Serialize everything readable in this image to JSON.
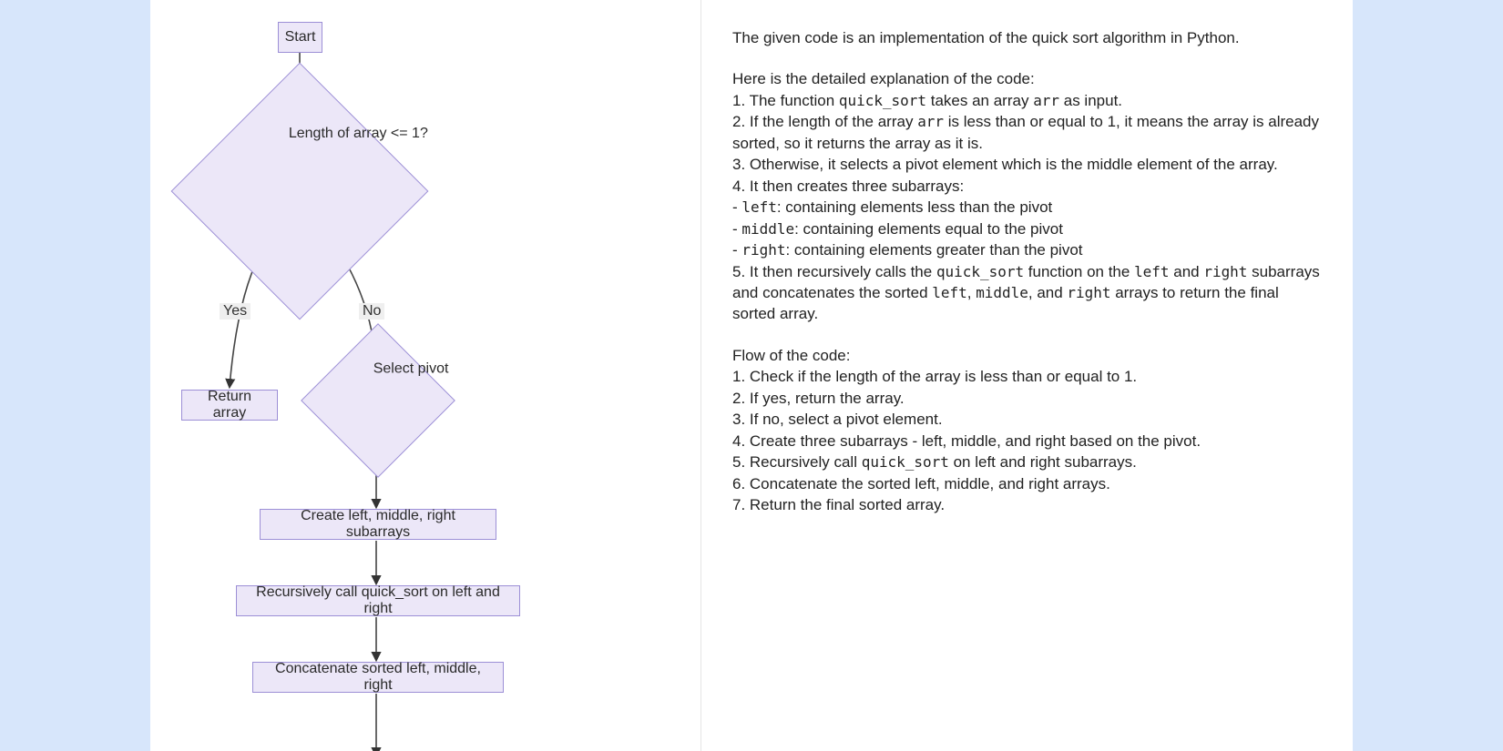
{
  "flowchart": {
    "nodes": {
      "start": "Start",
      "check": "Length of array <= 1?",
      "yes": "Yes",
      "no": "No",
      "return_array": "Return array",
      "select_pivot": "Select pivot",
      "create_subarrays": "Create left, middle, right subarrays",
      "recurse": "Recursively call quick_sort on left and right",
      "concat": "Concatenate sorted left, middle, right"
    }
  },
  "explanation": {
    "intro": "The given code is an implementation of the quick sort algorithm in Python.",
    "detail_heading": "Here is the detailed explanation of the code:",
    "details": [
      "1. The function `quick_sort` takes an array `arr` as input.",
      "2. If the length of the array `arr` is less than or equal to 1, it means the array is already sorted, so it returns the array as it is.",
      "3. Otherwise, it selects a pivot element which is the middle element of the array.",
      "4. It then creates three subarrays:",
      "- `left`: containing elements less than the pivot",
      "- `middle`: containing elements equal to the pivot",
      "- `right`: containing elements greater than the pivot",
      "5. It then recursively calls the `quick_sort` function on the `left` and `right` subarrays and concatenates the sorted `left`, `middle`, and `right` arrays to return the final sorted array."
    ],
    "flow_heading": "Flow of the code:",
    "flow_steps": [
      "1. Check if the length of the array is less than or equal to 1.",
      "2. If yes, return the array.",
      "3. If no, select a pivot element.",
      "4. Create three subarrays - left, middle, and right based on the pivot.",
      "5. Recursively call `quick_sort` on left and right subarrays.",
      "6. Concatenate the sorted left, middle, and right arrays.",
      "7. Return the final sorted array."
    ]
  }
}
